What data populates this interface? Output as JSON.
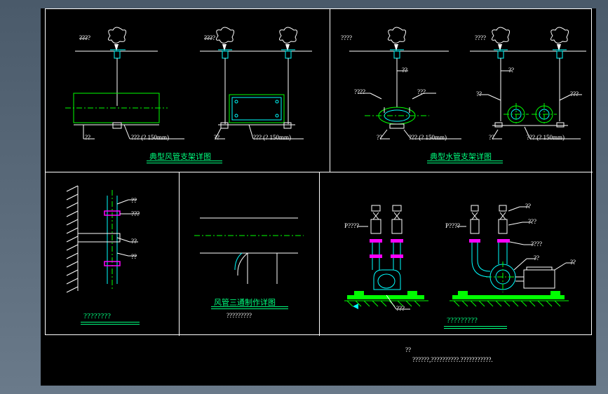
{
  "colors": {
    "background": "#000000",
    "gradient_top": "#4a5a6a",
    "gradient_bottom": "#6a7a8a",
    "line_primary": "#ffffff",
    "line_green": "#00ff00",
    "line_cyan": "#00ffff",
    "line_magenta": "#ff00ff",
    "title": "#00ff7f"
  },
  "panels": {
    "top_left": {
      "title": "典型风管支架详图",
      "labels": {
        "ceiling1": "????",
        "ceiling2": "????",
        "tag1": "??",
        "tag2": "??",
        "spec1": "??? (?  150mm)",
        "tag3": "??",
        "spec2": "??? (?  150mm)"
      }
    },
    "top_right": {
      "title": "典型水管支架详图",
      "labels": {
        "ceiling1": "????",
        "ceiling2": "????",
        "rod1": "??",
        "rod2": "??",
        "left1": "????",
        "left2": "???",
        "bottom1": "??",
        "spec1": "??? (?  150mm)",
        "right1": "??",
        "right2": "???",
        "bottom2": "??",
        "spec2": "??? (?  150mm)"
      }
    },
    "bottom_left": {
      "title": "????????",
      "labels": {
        "tag1": "??",
        "tag2": "???",
        "tag3": "??",
        "tag4": "??"
      }
    },
    "bottom_mid": {
      "title": "风管三通制作详图",
      "subtitle": "?????????"
    },
    "bottom_right": {
      "title": "?????????",
      "labels": {
        "p1": "P????",
        "p2": "P????",
        "tag1": "??",
        "tag2": "??",
        "tag3": "???",
        "tag4": "????",
        "tag5": "??",
        "tag6": "??",
        "tag7": "???"
      }
    }
  },
  "footer": {
    "line1": "??",
    "line2": "??????,??????????.???????????."
  }
}
